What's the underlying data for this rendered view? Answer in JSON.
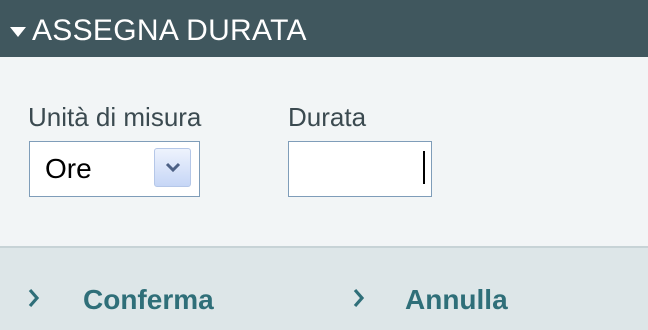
{
  "header": {
    "title": "ASSEGNA DURATA",
    "collapse_icon": "triangle-down-icon"
  },
  "form": {
    "unit_label": "Unità di misura",
    "unit_value": "Ore",
    "unit_dropdown_icon": "chevron-down-icon",
    "duration_label": "Durata",
    "duration_value": ""
  },
  "actions": {
    "confirm_label": "Conferma",
    "cancel_label": "Annulla",
    "chevron_icon": "chevron-right-icon"
  },
  "colors": {
    "header_bg": "#40575e",
    "form_bg": "#f2f5f6",
    "footer_bg": "#dde6e8",
    "accent_text": "#2f6f79"
  }
}
